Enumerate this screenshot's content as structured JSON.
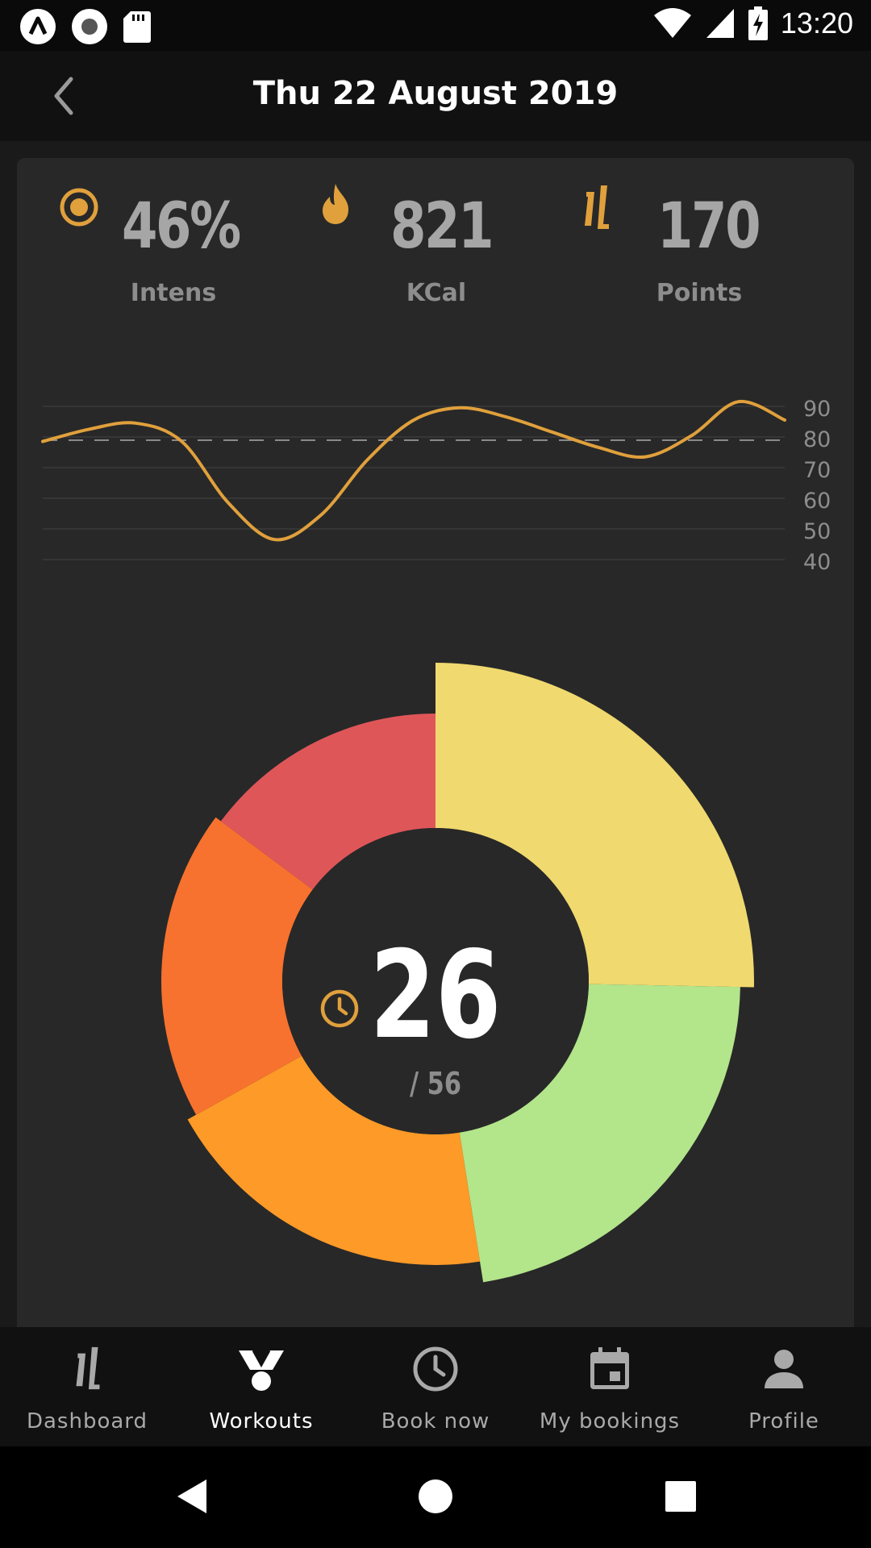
{
  "status_bar": {
    "time": "13:20",
    "icons": [
      "app-a-icon",
      "record-icon",
      "sd-card-icon",
      "wifi-icon",
      "signal-icon",
      "battery-charging-icon"
    ]
  },
  "header": {
    "title": "Thu 22 August 2019",
    "back_icon": "chevron-left-icon"
  },
  "stats": [
    {
      "icon": "target-icon",
      "value": "46%",
      "label": "Intens"
    },
    {
      "icon": "flame-icon",
      "value": "821",
      "label": "KCal"
    },
    {
      "icon": "points-logo-icon",
      "value": "170",
      "label": "Points"
    }
  ],
  "chart_data": {
    "type": "line",
    "x": [
      0,
      1,
      2,
      3,
      4,
      5,
      6,
      7,
      8,
      9,
      10,
      11,
      12,
      13,
      14,
      15,
      16
    ],
    "series": [
      {
        "values": [
          78,
          82,
          84,
          78,
          58,
          46,
          54,
          72,
          85,
          89,
          86,
          81,
          76,
          73,
          80,
          91,
          85
        ]
      }
    ],
    "reference_line": 80,
    "ytick_labels": [
      "90",
      "80",
      "70",
      "60",
      "50",
      "40"
    ],
    "ylim": [
      40,
      95
    ],
    "grid": true,
    "colors": {
      "line": "#e0a03c",
      "reference": "#8a8a8a",
      "grid": "#3a3a3a",
      "ticks": "#8d8d8d"
    }
  },
  "zones": {
    "type": "pie",
    "center_value": "26",
    "center_sub": "/ 56",
    "center_icon": "clock-icon",
    "slices": [
      {
        "zone": "yellow",
        "color": "#f0d96e",
        "fraction": 0.253
      },
      {
        "zone": "green",
        "color": "#b3e58b",
        "fraction": 0.222
      },
      {
        "zone": "orange",
        "color": "#fd9a28",
        "fraction": 0.194
      },
      {
        "zone": "dark-orange",
        "color": "#f7722e",
        "fraction": 0.183
      },
      {
        "zone": "red",
        "color": "#df5659",
        "fraction": 0.148
      }
    ]
  },
  "bottom_nav": {
    "items": [
      {
        "label": "Dashboard",
        "icon": "points-logo-icon",
        "active": false
      },
      {
        "label": "Workouts",
        "icon": "medal-icon",
        "active": true
      },
      {
        "label": "Book now",
        "icon": "clock-icon",
        "active": false
      },
      {
        "label": "My bookings",
        "icon": "calendar-icon",
        "active": false
      },
      {
        "label": "Profile",
        "icon": "person-icon",
        "active": false
      }
    ]
  },
  "system_nav": [
    "back-triangle-icon",
    "home-circle-icon",
    "recents-square-icon"
  ],
  "colors": {
    "accent": "#e0a03c",
    "card": "#282828",
    "bar": "#111111"
  }
}
